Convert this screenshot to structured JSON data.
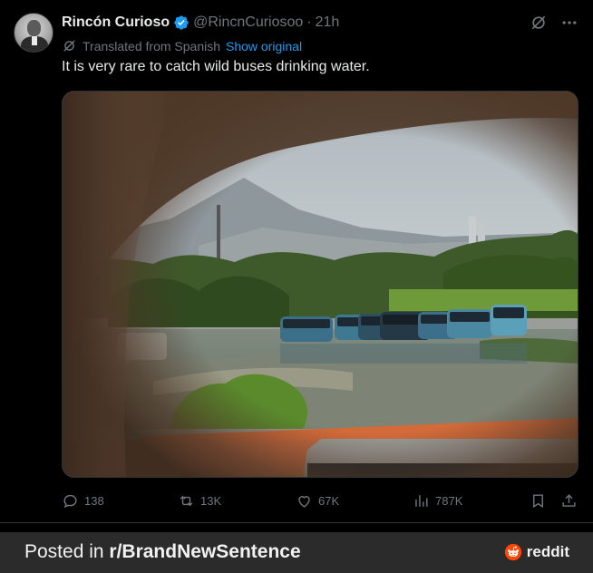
{
  "post": {
    "display_name": "Rincón Curioso",
    "handle": "@RincnCuriosoo",
    "separator": "·",
    "time": "21h",
    "translated_label": "Translated from Spanish",
    "show_original": "Show original",
    "text": "It is very rare to catch wild buses drinking water."
  },
  "actions": {
    "replies": "138",
    "reposts": "13K",
    "likes": "67K",
    "views": "787K"
  },
  "footer": {
    "posted_prefix": "Posted in ",
    "subreddit": "r/BrandNewSentence",
    "brand": "reddit"
  },
  "icons": [
    "grok-icon",
    "more-icon",
    "translate-icon",
    "verified-badge-icon",
    "reply-icon",
    "repost-icon",
    "like-icon",
    "views-icon",
    "bookmark-icon",
    "share-icon",
    "reddit-logo-icon"
  ],
  "colors": {
    "accent_blue": "#1d9bf0",
    "muted_text": "#71767b",
    "reddit_orange": "#ff4500",
    "footer_bg": "#2b2b2b"
  }
}
